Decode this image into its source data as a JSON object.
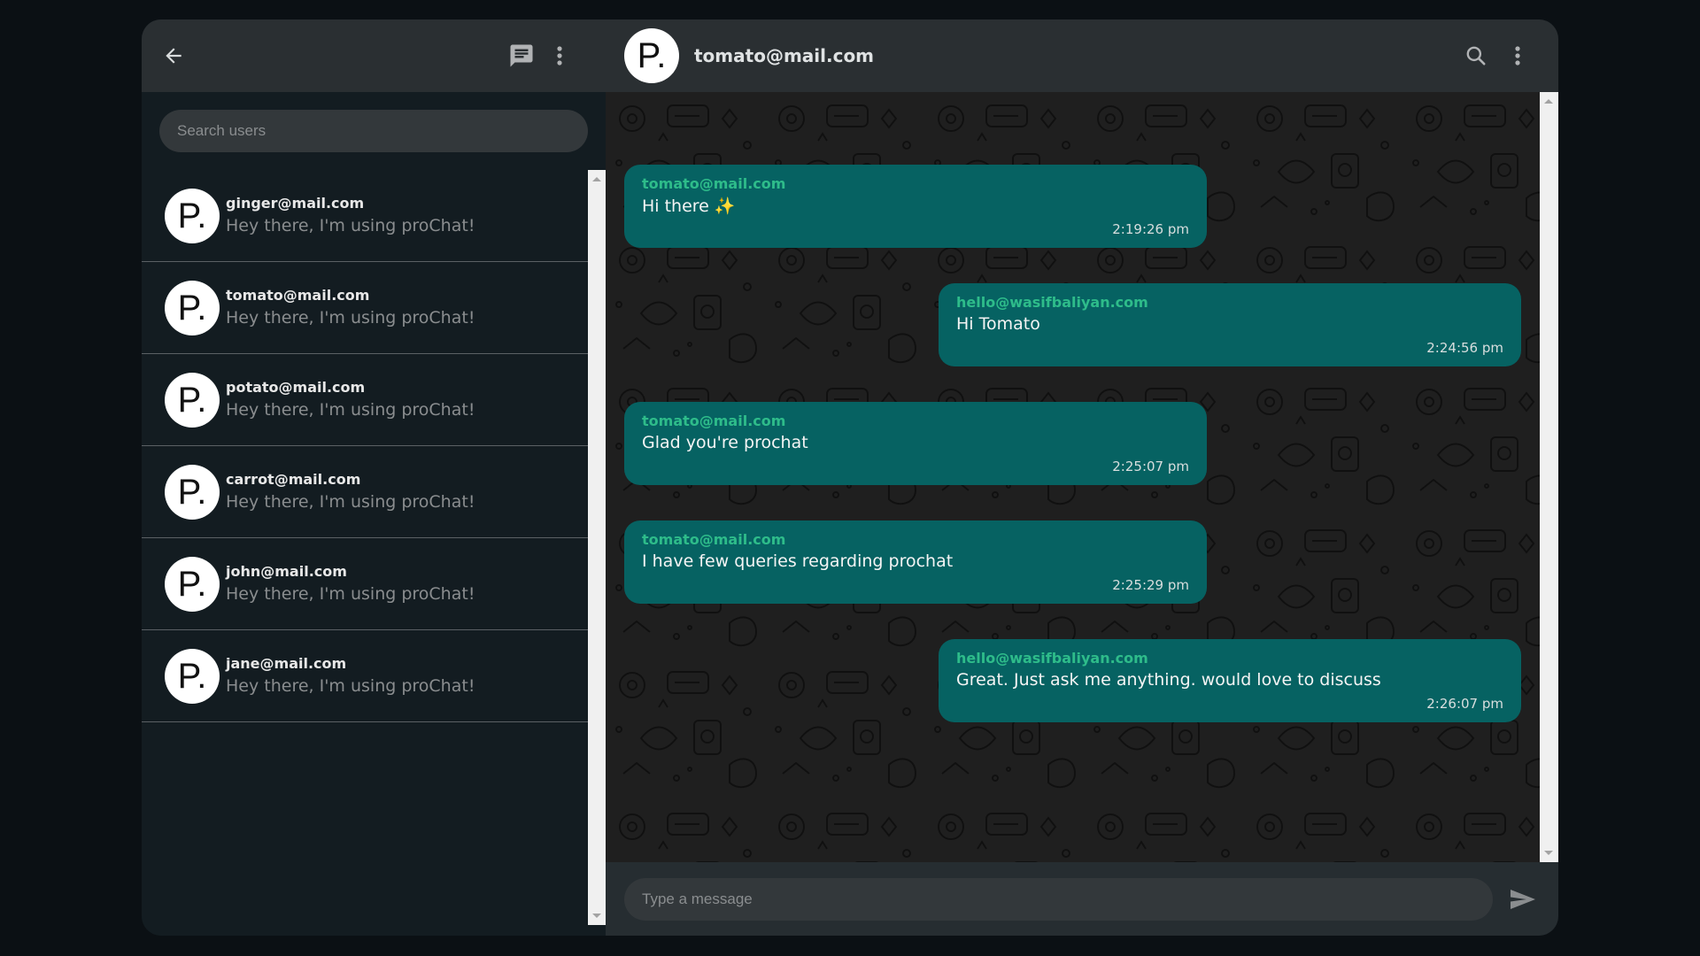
{
  "sidebar": {
    "search_placeholder": "Search users",
    "icons": {
      "back": "arrow-left-icon",
      "new_chat": "message-icon",
      "menu": "more-vertical-icon"
    },
    "users": [
      {
        "avatar": "P.",
        "email": "ginger@mail.com",
        "status": "Hey there, I'm using proChat!"
      },
      {
        "avatar": "P.",
        "email": "tomato@mail.com",
        "status": "Hey there, I'm using proChat!"
      },
      {
        "avatar": "P.",
        "email": "potato@mail.com",
        "status": "Hey there, I'm using proChat!"
      },
      {
        "avatar": "P.",
        "email": "carrot@mail.com",
        "status": "Hey there, I'm using proChat!"
      },
      {
        "avatar": "P.",
        "email": "john@mail.com",
        "status": "Hey there, I'm using proChat!"
      },
      {
        "avatar": "P.",
        "email": "jane@mail.com",
        "status": "Hey there, I'm using proChat!"
      }
    ]
  },
  "chat": {
    "avatar": "P.",
    "title": "tomato@mail.com",
    "icons": {
      "search": "search-icon",
      "menu": "more-vertical-icon",
      "send": "send-icon"
    },
    "input_placeholder": "Type a message",
    "messages": [
      {
        "side": "left",
        "sender": "tomato@mail.com",
        "text": "Hi there ✨",
        "time": "2:19:26 pm"
      },
      {
        "side": "right",
        "sender": "hello@wasifbaliyan.com",
        "text": "Hi Tomato",
        "time": "2:24:56 pm"
      },
      {
        "side": "left",
        "sender": "tomato@mail.com",
        "text": "Glad you're prochat",
        "time": "2:25:07 pm"
      },
      {
        "side": "left",
        "sender": "tomato@mail.com",
        "text": "I have few queries regarding prochat",
        "time": "2:25:29 pm"
      },
      {
        "side": "right",
        "sender": "hello@wasifbaliyan.com",
        "text": "Great. Just ask me anything. would love to discuss",
        "time": "2:26:07 pm"
      }
    ]
  },
  "colors": {
    "bubble": "#066262",
    "sender": "#2ebc8a",
    "header": "#2a2f32",
    "sidebar": "#131c21"
  }
}
